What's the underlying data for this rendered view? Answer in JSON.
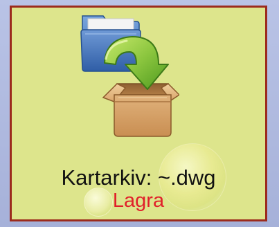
{
  "panel": {
    "caption": "Kartarkiv: ~.dwg",
    "action_label": "Lagra"
  },
  "icons": {
    "main": "archive-save-icon",
    "folder": "folder-icon",
    "arrow": "curved-arrow-down-icon",
    "box": "open-box-icon"
  },
  "colors": {
    "panel_background": "#dde58c",
    "panel_border": "#9c2b1d",
    "caption_text": "#111111",
    "action_text": "#e0202a",
    "page_background": "#a8b4dc"
  }
}
